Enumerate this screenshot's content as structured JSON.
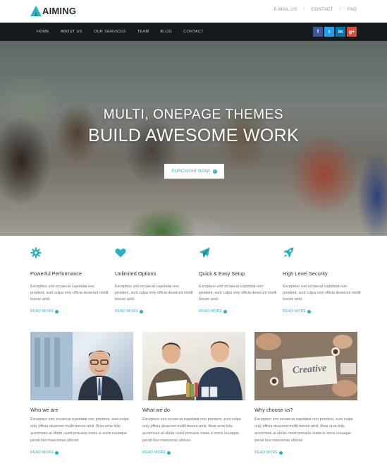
{
  "header": {
    "logo_text": "AIMING",
    "top_links": [
      "E-MAIL US",
      "CONTACT",
      "FAQ"
    ],
    "separator": "/"
  },
  "nav": {
    "items": [
      "HOME",
      "ABOUT US",
      "OUR SERVICES",
      "TEAM",
      "BLOG",
      "CONTACT"
    ]
  },
  "socials": [
    {
      "glyph": "f",
      "icon": "facebook-icon",
      "color": "#3b5998"
    },
    {
      "glyph": "t",
      "icon": "twitter-icon",
      "color": "#1da1f2"
    },
    {
      "glyph": "in",
      "icon": "linkedin-icon",
      "color": "#0077b5"
    },
    {
      "glyph": "g+",
      "icon": "google-plus-icon",
      "color": "#dd4b39"
    }
  ],
  "hero": {
    "subtitle": "MULTI, ONEPAGE THEMES",
    "title": "BUILD AWESOME WORK",
    "button_label": "PURCHASE NOW!"
  },
  "features": [
    {
      "icon": "gear-icon",
      "title": "Powerful Performance",
      "desc": "Excepteur sint occaecat cupidatat non proident, sunt culpa only officia deserunt mollit borum amit.",
      "link": "READ MORE"
    },
    {
      "icon": "heart-icon",
      "title": "Unlimited Options",
      "desc": "Excepteur sint occaecat cupidatat non proident, sunt culpa only officia deserunt mollit borum amit.",
      "link": "READ MORE"
    },
    {
      "icon": "paper-plane-icon",
      "title": "Quick & Easy Setup",
      "desc": "Excepteur sint occaecat cupidatat non proident, sunt culpa only officia deserunt mollit borum amit.",
      "link": "READ MORE"
    },
    {
      "icon": "rocket-icon",
      "title": "High Level Security",
      "desc": "Excepteur sint occaecat cupidatat non proident, sunt culpa only officia deserunt mollit borum amit.",
      "link": "READ MORE"
    }
  ],
  "cards": [
    {
      "title": "Who we are",
      "desc": "Excepteur sint occaecat cupidatat non proident, sunt culpa only officia deserunt mollit borum amit. Bras urna felis accumsan at ultrde cesid posuere masa is socis nouaque penat bus maecenas ultrices",
      "link": "READ MORE"
    },
    {
      "title": "What we do",
      "desc": "Excepteur sint occaecat cupidatat non proident, sunt culpa only officia deserunt mollit borum amit. Bras urna felis accumsan at ultrde cesid posuere masa is socis nouaque penat bus maecenas ultrices",
      "link": "READ MORE"
    },
    {
      "title": "Why choose us?",
      "desc": "Excepteur sint occaecat cupidatat non proident, sunt culpa only officia deserunt mollit borum amit. Bras urna felis accumsan at ultrde cesid posuere masa is socis nouaque penat bus maecenas ultrices",
      "link": "READ MORE",
      "image_text": "Creative"
    }
  ],
  "colors": {
    "accent": "#27b3c6",
    "nav_bg": "#161a1d"
  }
}
